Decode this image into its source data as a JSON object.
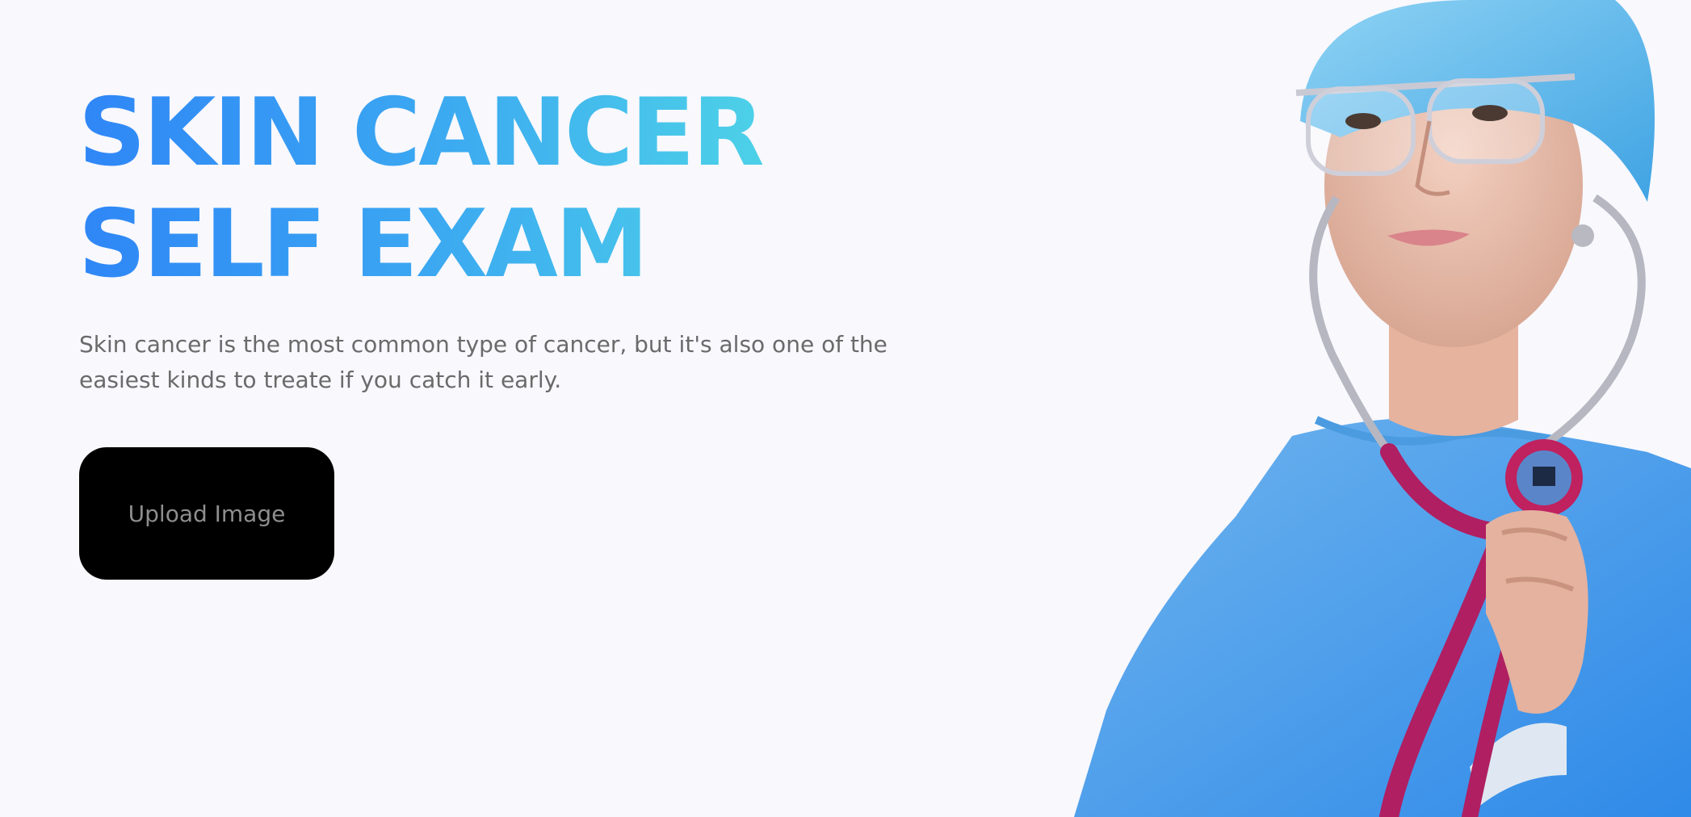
{
  "hero": {
    "title_line1": "SKIN CANCER",
    "title_line2": "SELF EXAM",
    "description": "Skin cancer is the most common type of cancer, but it's also one of the easiest kinds to treate if you catch it early.",
    "upload_button_label": "Upload Image"
  },
  "colors": {
    "background": "#f8f8fd",
    "title_gradient_start": "#2f86f6",
    "title_gradient_end": "#4fd6e6",
    "button_background": "#000000",
    "button_text": "#8e8e8e",
    "body_text": "#6a6a6a"
  },
  "image": {
    "subject": "doctor-with-stethoscope"
  }
}
